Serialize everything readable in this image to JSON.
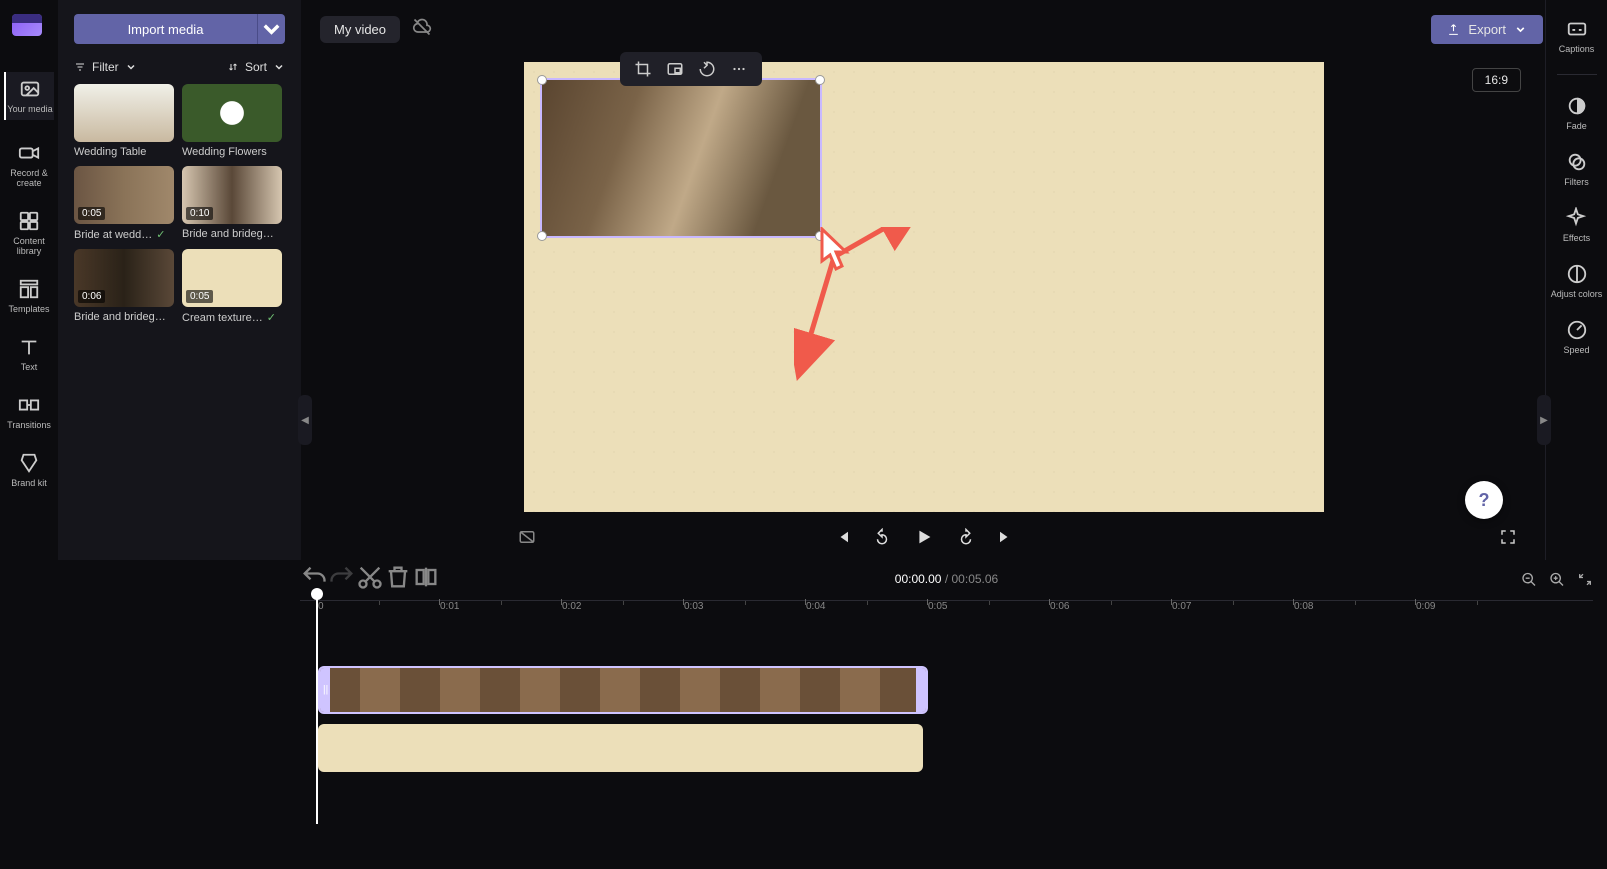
{
  "project_title": "My video",
  "import_label": "Import media",
  "filter_label": "Filter",
  "sort_label": "Sort",
  "export_label": "Export",
  "aspect_ratio": "16:9",
  "captions_label": "Captions",
  "time": {
    "current": "00:00.00",
    "sep": " / ",
    "total": "00:05.06"
  },
  "nav": [
    {
      "key": "your-media",
      "label": "Your media"
    },
    {
      "key": "record",
      "label": "Record & create"
    },
    {
      "key": "content",
      "label": "Content library"
    },
    {
      "key": "templates",
      "label": "Templates"
    },
    {
      "key": "text",
      "label": "Text"
    },
    {
      "key": "transitions",
      "label": "Transitions"
    },
    {
      "key": "brand",
      "label": "Brand kit"
    }
  ],
  "right_rail": [
    {
      "key": "fade",
      "label": "Fade"
    },
    {
      "key": "filters",
      "label": "Filters"
    },
    {
      "key": "effects",
      "label": "Effects"
    },
    {
      "key": "adjust",
      "label": "Adjust colors"
    },
    {
      "key": "speed",
      "label": "Speed"
    }
  ],
  "media": [
    {
      "name": "Wedding Table",
      "dur": "",
      "cls": "t-wedding-table",
      "used": false
    },
    {
      "name": "Wedding Flowers",
      "dur": "",
      "cls": "t-flowers",
      "used": false
    },
    {
      "name": "Bride at wedd…",
      "dur": "0:05",
      "cls": "t-bride",
      "used": true
    },
    {
      "name": "Bride and brideg…",
      "dur": "0:10",
      "cls": "t-bride2",
      "used": false
    },
    {
      "name": "Bride and brideg…",
      "dur": "0:06",
      "cls": "t-bride3",
      "used": false
    },
    {
      "name": "Cream texture…",
      "dur": "0:05",
      "cls": "t-cream",
      "used": true
    }
  ],
  "ruler": [
    "0",
    "0:01",
    "0:02",
    "0:03",
    "0:04",
    "0:05",
    "0:06",
    "0:07",
    "0:08",
    "0:09"
  ],
  "colors": {
    "accent": "#6264a7",
    "canvas_bg": "#ecdfb9",
    "annotation": "#f05a4b"
  }
}
